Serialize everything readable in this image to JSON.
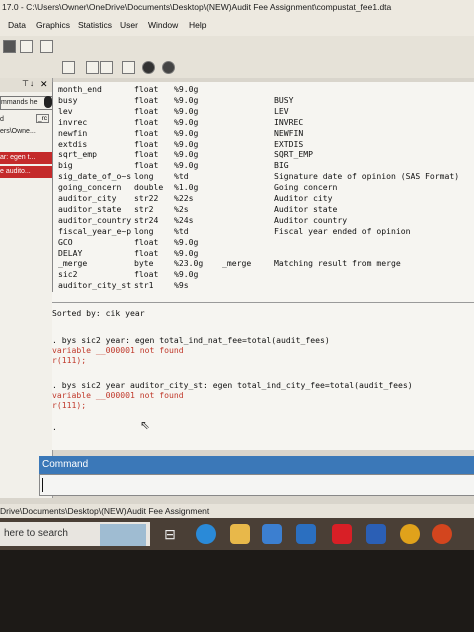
{
  "window": {
    "title": "17.0 - C:\\Users\\Owner\\OneDrive\\Documents\\Desktop\\(NEW)Audit Fee Assignment\\compustat_fee1.dta"
  },
  "menu": [
    "Data",
    "Graphics",
    "Statistics",
    "User",
    "Window",
    "Help"
  ],
  "left_pane": {
    "items": [
      "mmands he",
      "d",
      "ers\\Owne...",
      "ar: egen t...",
      "e audito..."
    ],
    "badge": "_rc"
  },
  "variables": [
    {
      "name": "month_end",
      "type": "float",
      "format": "%9.0g",
      "value_label": "",
      "label": ""
    },
    {
      "name": "busy",
      "type": "float",
      "format": "%9.0g",
      "value_label": "",
      "label": "BUSY"
    },
    {
      "name": "lev",
      "type": "float",
      "format": "%9.0g",
      "value_label": "",
      "label": "LEV"
    },
    {
      "name": "invrec",
      "type": "float",
      "format": "%9.0g",
      "value_label": "",
      "label": "INVREC"
    },
    {
      "name": "newfin",
      "type": "float",
      "format": "%9.0g",
      "value_label": "",
      "label": "NEWFIN"
    },
    {
      "name": "extdis",
      "type": "float",
      "format": "%9.0g",
      "value_label": "",
      "label": "EXTDIS"
    },
    {
      "name": "sqrt_emp",
      "type": "float",
      "format": "%9.0g",
      "value_label": "",
      "label": "SQRT_EMP"
    },
    {
      "name": "big",
      "type": "float",
      "format": "%9.0g",
      "value_label": "",
      "label": "BIG"
    },
    {
      "name": "sig_date_of_o~s",
      "type": "long",
      "format": "%td",
      "value_label": "",
      "label": "Signature date of opinion (SAS Format)"
    },
    {
      "name": "going_concern",
      "type": "double",
      "format": "%1.0g",
      "value_label": "",
      "label": "Going concern"
    },
    {
      "name": "auditor_city",
      "type": "str22",
      "format": "%22s",
      "value_label": "",
      "label": "Auditor city"
    },
    {
      "name": "auditor_state",
      "type": "str2",
      "format": "%2s",
      "value_label": "",
      "label": "Auditor state"
    },
    {
      "name": "auditor_country",
      "type": "str24",
      "format": "%24s",
      "value_label": "",
      "label": "Auditor country"
    },
    {
      "name": "fiscal_year_e~p",
      "type": "long",
      "format": "%td",
      "value_label": "",
      "label": "Fiscal year ended of opinion"
    },
    {
      "name": "GCO",
      "type": "float",
      "format": "%9.0g",
      "value_label": "",
      "label": ""
    },
    {
      "name": "DELAY",
      "type": "float",
      "format": "%9.0g",
      "value_label": "",
      "label": ""
    },
    {
      "name": "_merge",
      "type": "byte",
      "format": "%23.0g",
      "value_label": "_merge",
      "label": "Matching result from merge"
    },
    {
      "name": "sic2",
      "type": "float",
      "format": "%9.0g",
      "value_label": "",
      "label": ""
    },
    {
      "name": "auditor_city_st",
      "type": "str1",
      "format": "%9s",
      "value_label": "",
      "label": ""
    }
  ],
  "output": {
    "sorted_by": "Sorted by: cik  year",
    "cmd1": ". bys sic2 year: egen total_ind_nat_fee=total(audit_fees)",
    "err1": "variable __000001 not found",
    "rc1": "r(111);",
    "cmd2": ". bys sic2 year auditor_city_st: egen total_ind_city_fee=total(audit_fees)",
    "err2": "variable __000001 not found",
    "rc2": "r(111);",
    "prompt": "."
  },
  "command_panel": {
    "title": "Command"
  },
  "status_bar": {
    "text": "Drive\\Documents\\Desktop\\(NEW)Audit Fee Assignment"
  },
  "taskbar": {
    "search_placeholder": "here to search"
  },
  "colors": {
    "command_bar": "#3b78b8",
    "error_red": "#c0392b",
    "window_bg": "#f6f5f1"
  }
}
